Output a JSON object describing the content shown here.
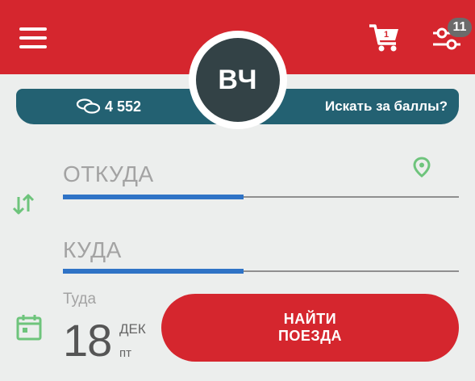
{
  "header": {
    "cart_count": "1",
    "filter_badge": "11"
  },
  "avatar": {
    "initials": "ВЧ"
  },
  "points": {
    "value": "4 552",
    "link": "Искать за баллы?"
  },
  "form": {
    "from_placeholder": "ОТКУДА",
    "to_placeholder": "КУДА",
    "date_label": "Туда",
    "date_day": "18",
    "date_month": "ДЕК",
    "date_weekday": "пт",
    "search_button": "НАЙТИ\nПОЕЗДА"
  },
  "colors": {
    "brand_red": "#d5262e",
    "points_teal": "#236172",
    "focus_blue": "#2f73c6",
    "icon_green": "#6ec47c",
    "avatar_dark": "#334246"
  },
  "icons": {
    "menu": "menu-icon",
    "cart": "cart-icon",
    "filter": "filter-icon",
    "coins": "coins-icon",
    "location": "location-pin-icon",
    "swap": "swap-icon",
    "calendar": "calendar-icon"
  }
}
